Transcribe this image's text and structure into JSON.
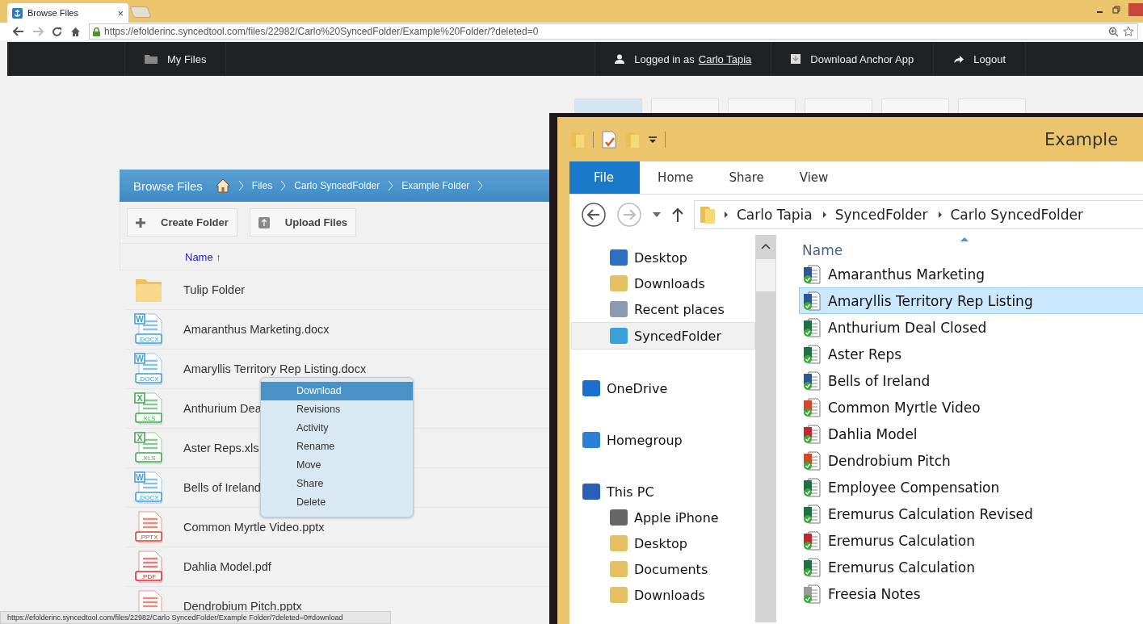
{
  "browser": {
    "tab_title": "Browse Files",
    "tab_close": "×",
    "url": "https://efolderinc.syncedtool.com/files/22982/Carlo%20SyncedFolder/Example%20Folder/?deleted=0"
  },
  "navbar": {
    "my_files": "My Files",
    "logged_in_prefix": "Logged in as",
    "user": "Carlo Tapia",
    "download_app": "Download Anchor App",
    "logout": "Logout"
  },
  "tiles": [
    {
      "selected": true
    },
    {
      "selected": false
    },
    {
      "selected": false
    },
    {
      "selected": false
    },
    {
      "selected": false
    },
    {
      "selected": false
    }
  ],
  "browse": {
    "title": "Browse Files",
    "breadcrumbs": [
      "Files",
      "Carlo SyncedFolder",
      "Example Folder"
    ],
    "create_folder": "Create Folder",
    "upload_files": "Upload Files",
    "sort_label": "Name",
    "sort_arrow": "↑"
  },
  "rows": [
    {
      "kind": "folder",
      "name": "Tulip Folder"
    },
    {
      "kind": "docx",
      "name": "Amaranthus Marketing.docx",
      "icon_letter": "W",
      "icon_badge": ".DOCX"
    },
    {
      "kind": "docx",
      "name": "Amaryllis Territory Rep Listing.docx",
      "icon_letter": "W",
      "icon_badge": ".DOCX"
    },
    {
      "kind": "xls",
      "name": "Anthurium Dea",
      "icon_letter": "X",
      "icon_badge": ".XLS"
    },
    {
      "kind": "xls",
      "name": "Aster Reps.xls",
      "icon_letter": "X",
      "icon_badge": ".XLS"
    },
    {
      "kind": "docx",
      "name": "Bells of Ireland",
      "icon_letter": "W",
      "icon_badge": ".DOCX"
    },
    {
      "kind": "pptx",
      "name": "Common Myrtle Video.pptx",
      "icon_badge": ".PPTX"
    },
    {
      "kind": "pdf",
      "name": "Dahlia Model.pdf",
      "icon_badge": ".PDF"
    },
    {
      "kind": "pptx",
      "name": "Dendrobium Pitch.pptx"
    }
  ],
  "context_menu": [
    {
      "label": "Download",
      "selected": true
    },
    {
      "label": "Revisions",
      "selected": false
    },
    {
      "label": "Activity",
      "selected": false
    },
    {
      "label": "Rename",
      "selected": false
    },
    {
      "label": "Move",
      "selected": false
    },
    {
      "label": "Share",
      "selected": false
    },
    {
      "label": "Delete",
      "selected": false
    }
  ],
  "status_url": "https://efolderinc.syncedtool.com/files/22982/Carlo SyncedFolder/Example Folder/?deleted=0#download",
  "explorer": {
    "title": "Example",
    "ribbon_tabs": [
      {
        "label": "File",
        "selected": true
      },
      {
        "label": "Home",
        "selected": false
      },
      {
        "label": "Share",
        "selected": false
      },
      {
        "label": "View",
        "selected": false
      }
    ],
    "address": [
      "Carlo Tapia",
      "SyncedFolder",
      "Carlo SyncedFolder"
    ],
    "favorites": [
      {
        "kind": "desktop",
        "label": "Desktop",
        "selected": false
      },
      {
        "kind": "downloads",
        "label": "Downloads",
        "selected": false
      },
      {
        "kind": "recent",
        "label": "Recent places",
        "selected": false
      },
      {
        "kind": "synced",
        "label": "SyncedFolder",
        "selected": true
      }
    ],
    "nav_tree": [
      {
        "kind": "onedrive",
        "label": "OneDrive"
      },
      {
        "kind": "homegroup",
        "label": "Homegroup"
      },
      {
        "kind": "pc",
        "label": "This PC",
        "children": [
          {
            "kind": "phone",
            "label": "Apple iPhone"
          },
          {
            "kind": "desktop-folder",
            "label": "Desktop"
          },
          {
            "kind": "documents",
            "label": "Documents"
          },
          {
            "kind": "downloads",
            "label": "Downloads"
          }
        ]
      }
    ],
    "column": "Name",
    "files": [
      {
        "kind": "word",
        "name": "Amaranthus Marketing",
        "selected": false
      },
      {
        "kind": "word",
        "name": "Amaryllis Territory Rep Listing",
        "selected": true
      },
      {
        "kind": "excel",
        "name": "Anthurium Deal Closed",
        "selected": false
      },
      {
        "kind": "excel",
        "name": "Aster Reps",
        "selected": false
      },
      {
        "kind": "word",
        "name": "Bells of Ireland",
        "selected": false
      },
      {
        "kind": "powerpoint",
        "name": "Common Myrtle Video",
        "selected": false
      },
      {
        "kind": "pdf",
        "name": "Dahlia Model",
        "selected": false
      },
      {
        "kind": "powerpoint",
        "name": "Dendrobium Pitch",
        "selected": false
      },
      {
        "kind": "excel",
        "name": "Employee Compensation",
        "selected": false
      },
      {
        "kind": "excel",
        "name": "Eremurus Calculation Revised",
        "selected": false
      },
      {
        "kind": "pdf",
        "name": "Eremurus Calculation",
        "selected": false
      },
      {
        "kind": "excel",
        "name": "Eremurus Calculation",
        "selected": false
      },
      {
        "kind": "text",
        "name": "Freesia Notes",
        "selected": false
      }
    ]
  }
}
